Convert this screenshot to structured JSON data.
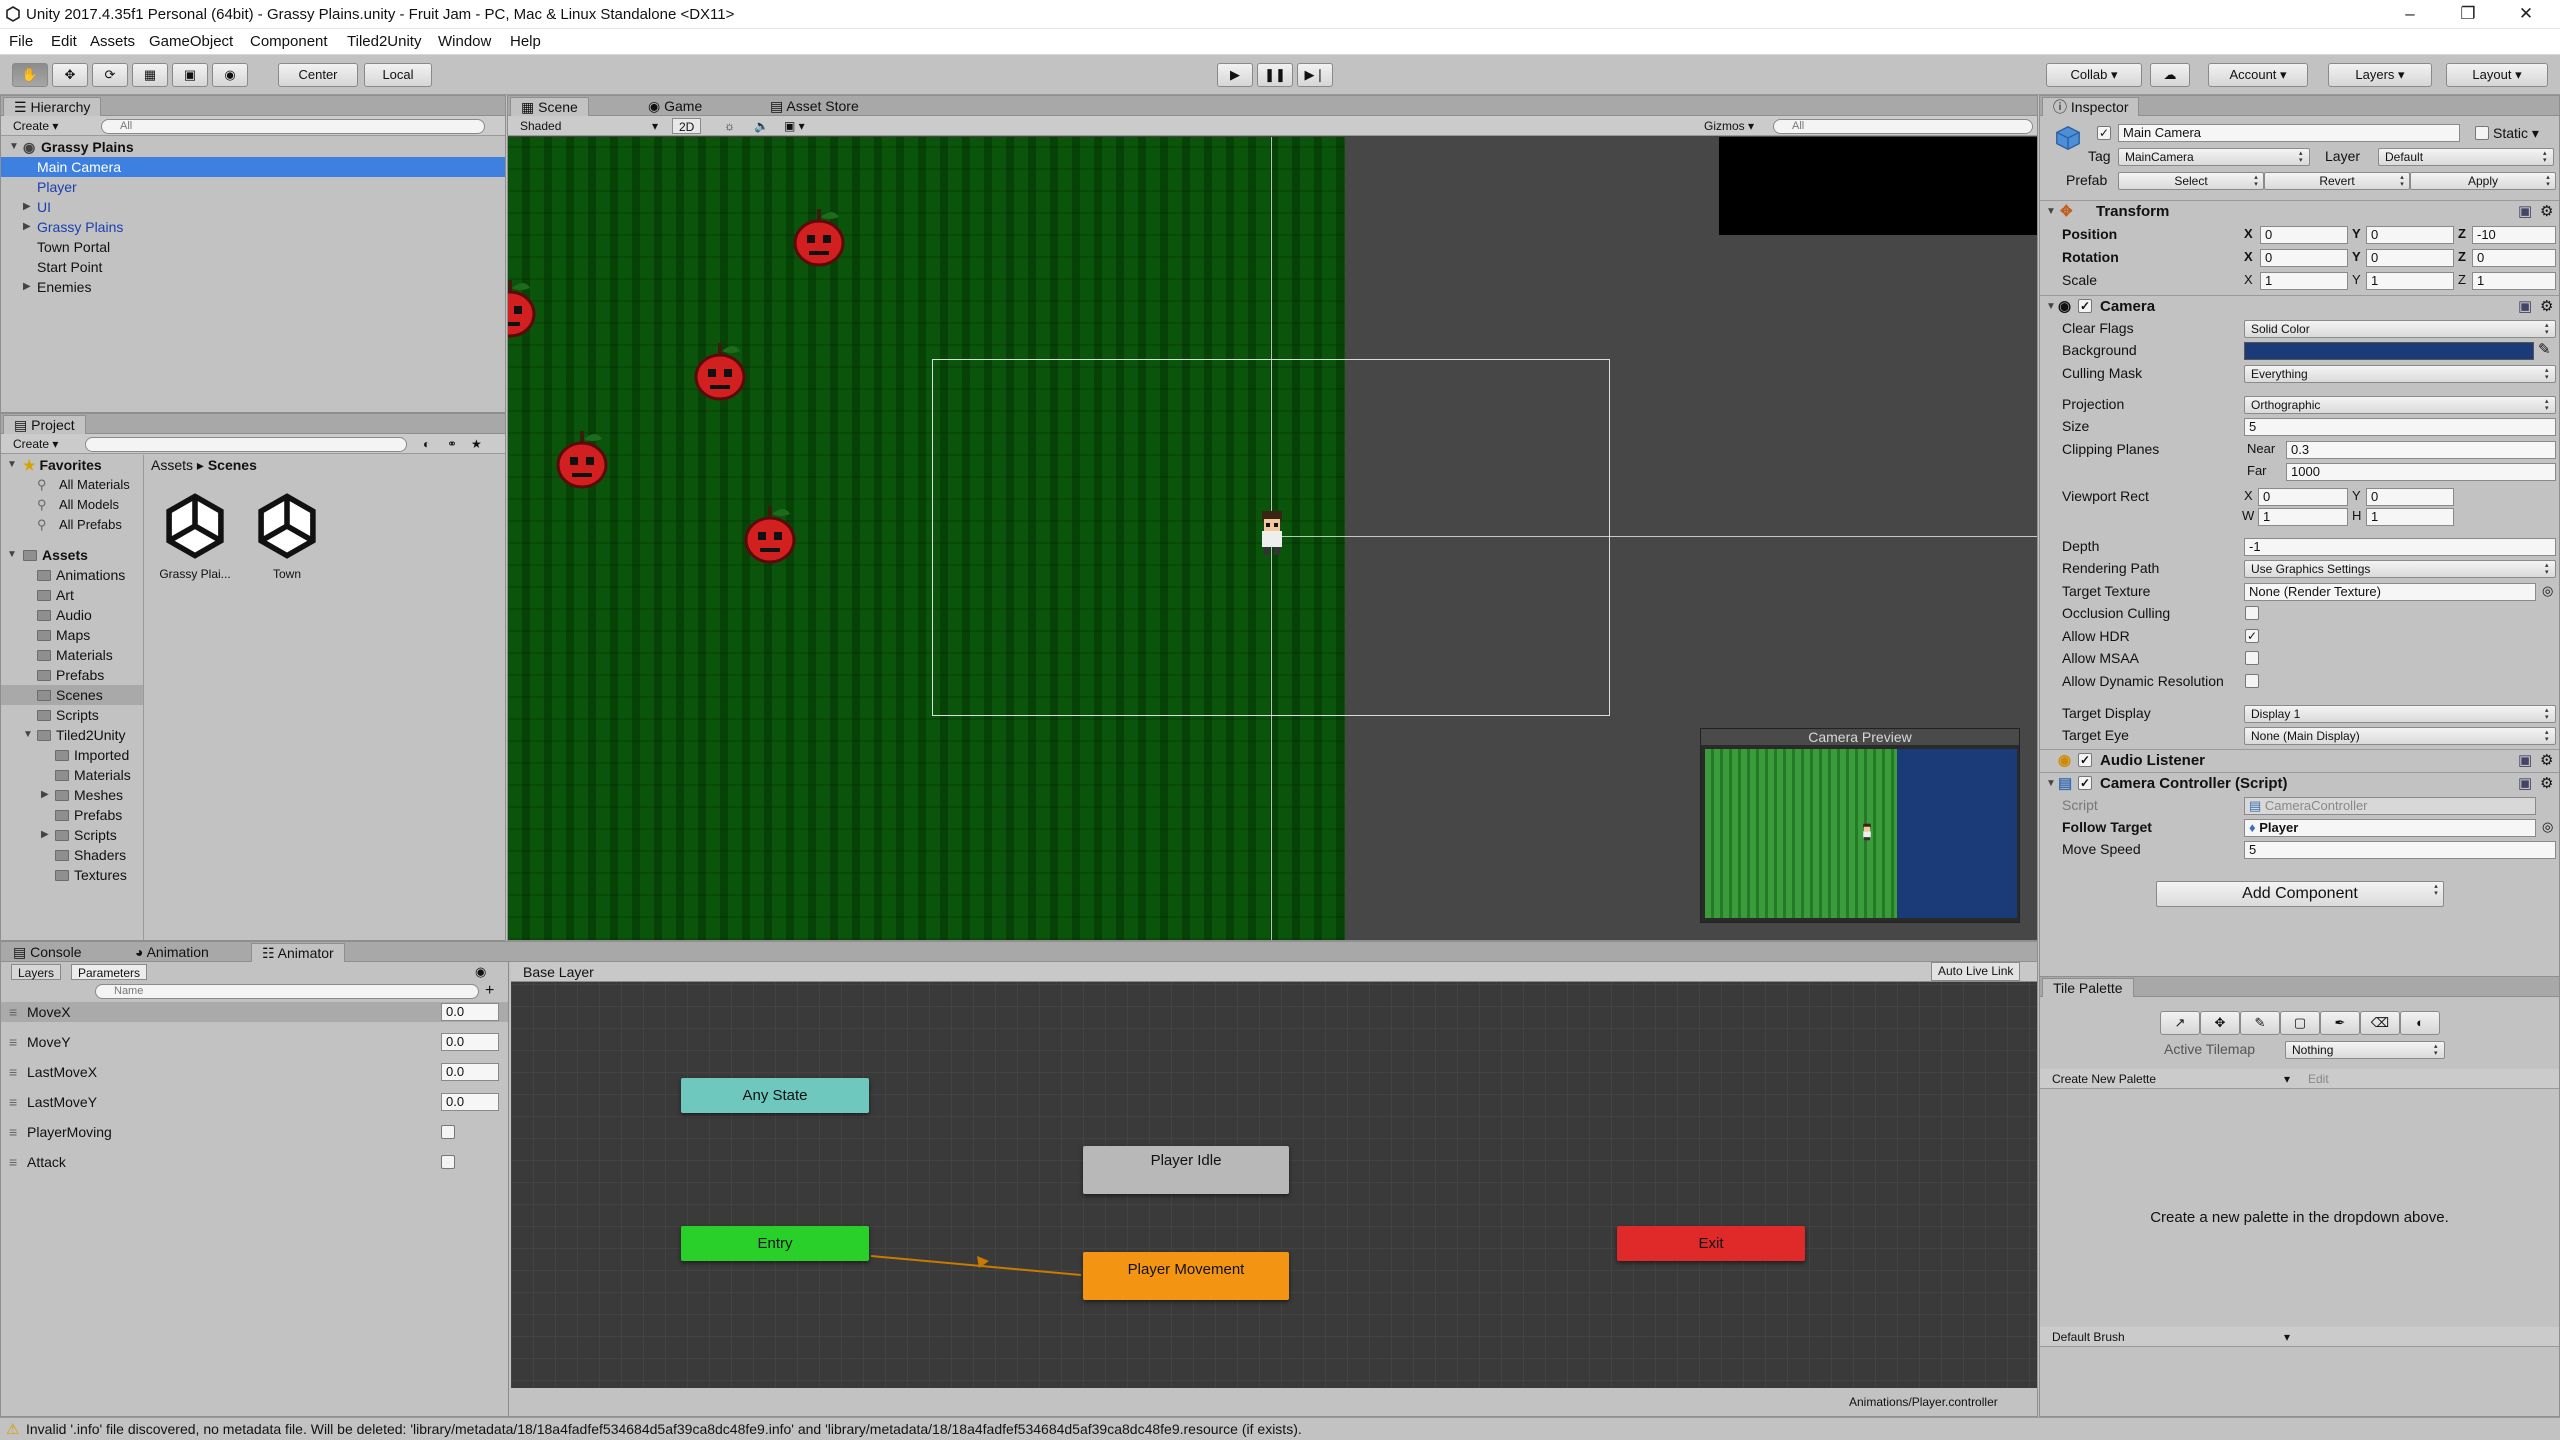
{
  "window": {
    "title": "Unity 2017.4.35f1 Personal (64bit) - Grassy Plains.unity - Fruit Jam - PC, Mac & Linux Standalone <DX11>"
  },
  "menu": [
    "File",
    "Edit",
    "Assets",
    "GameObject",
    "Component",
    "Tiled2Unity",
    "Window",
    "Help"
  ],
  "toolbar": {
    "pivot": "Center",
    "space": "Local",
    "collab": "Collab ▾",
    "account": "Account",
    "layers": "Layers",
    "layout": "Layout"
  },
  "hierarchy": {
    "title": "Hierarchy",
    "create": "Create ▾",
    "search": "All",
    "scene": "Grassy Plains",
    "items": [
      {
        "label": "Main Camera"
      },
      {
        "label": "Player"
      },
      {
        "label": "UI"
      },
      {
        "label": "Grassy Plains"
      },
      {
        "label": "Town Portal"
      },
      {
        "label": "Start Point"
      },
      {
        "label": "Enemies"
      }
    ]
  },
  "project": {
    "title": "Project",
    "create": "Create ▾",
    "favorites": "Favorites",
    "fav_items": [
      "All Materials",
      "All Models",
      "All Prefabs"
    ],
    "assets": "Assets",
    "asset_items": [
      "Animations",
      "Art",
      "Audio",
      "Maps",
      "Materials",
      "Prefabs",
      "Scenes",
      "Scripts",
      "Tiled2Unity"
    ],
    "tiled_items": [
      "Imported",
      "Materials",
      "Meshes",
      "Prefabs",
      "Scripts",
      "Shaders",
      "Textures"
    ],
    "crumb1": "Assets",
    "crumb2": "Scenes",
    "files": [
      "Grassy Plai...",
      "Town"
    ]
  },
  "scene": {
    "tabs": [
      "Scene",
      "Game",
      "Asset Store"
    ],
    "shading": "Shaded",
    "mode2d": "2D",
    "gizmos": "Gizmos ▾",
    "search": "All",
    "preview_title": "Camera Preview"
  },
  "inspector": {
    "title": "Inspector",
    "object": "Main Camera",
    "static": "Static",
    "tag_label": "Tag",
    "tag": "MainCamera",
    "layer_label": "Layer",
    "layer": "Default",
    "prefab_label": "Prefab",
    "prefab_select": "Select",
    "prefab_revert": "Revert",
    "prefab_apply": "Apply",
    "transform": {
      "title": "Transform",
      "position": "Position",
      "rotation": "Rotation",
      "scale": "Scale",
      "pos": [
        "0",
        "0",
        "-10"
      ],
      "rot": [
        "0",
        "0",
        "0"
      ],
      "scl": [
        "1",
        "1",
        "1"
      ]
    },
    "camera": {
      "title": "Camera",
      "clear_flags_l": "Clear Flags",
      "clear_flags": "Solid Color",
      "background_l": "Background",
      "background_color": "#1b3a78",
      "culling_l": "Culling Mask",
      "culling": "Everything",
      "projection_l": "Projection",
      "projection": "Orthographic",
      "size_l": "Size",
      "size": "5",
      "clipping_l": "Clipping Planes",
      "near_l": "Near",
      "near": "0.3",
      "far_l": "Far",
      "far": "1000",
      "viewport_l": "Viewport Rect",
      "vx": "0",
      "vy": "0",
      "vw": "1",
      "vh": "1",
      "depth_l": "Depth",
      "depth": "-1",
      "rpath_l": "Rendering Path",
      "rpath": "Use Graphics Settings",
      "ttex_l": "Target Texture",
      "ttex": "None (Render Texture)",
      "occ_l": "Occlusion Culling",
      "hdr_l": "Allow HDR",
      "msaa_l": "Allow MSAA",
      "dyn_l": "Allow Dynamic Resolution",
      "tdisp_l": "Target Display",
      "tdisp": "Display 1",
      "teye_l": "Target Eye",
      "teye": "None (Main Display)"
    },
    "audio": "Audio Listener",
    "controller": {
      "title": "Camera Controller (Script)",
      "script_l": "Script",
      "script": "CameraController",
      "follow_l": "Follow Target",
      "follow": "Player",
      "speed_l": "Move Speed",
      "speed": "5"
    },
    "add_component": "Add Component"
  },
  "bottom": {
    "tabs": [
      "Console",
      "Animation",
      "Animator"
    ],
    "layers_tab": "Layers",
    "params_tab": "Parameters",
    "search": "Name",
    "params": [
      {
        "name": "MoveX",
        "value": "0.0"
      },
      {
        "name": "MoveY",
        "value": "0.0"
      },
      {
        "name": "LastMoveX",
        "value": "0.0"
      },
      {
        "name": "LastMoveY",
        "value": "0.0"
      },
      {
        "name": "PlayerMoving",
        "value": ""
      },
      {
        "name": "Attack",
        "value": ""
      }
    ],
    "base_layer": "Base Layer",
    "auto_live": "Auto Live Link",
    "states": {
      "any": "Any State",
      "entry": "Entry",
      "idle": "Player Idle",
      "movement": "Player Movement",
      "exit": "Exit"
    },
    "controller_path": "Animations/Player.controller"
  },
  "tile_palette": {
    "title": "Tile Palette",
    "active_l": "Active Tilemap",
    "active": "Nothing",
    "create": "Create New Palette",
    "edit": "Edit",
    "hint": "Create a new palette in the dropdown above.",
    "brush": "Default Brush"
  },
  "status": "Invalid '.info' file discovered, no metadata file. Will be deleted: 'library/metadata/18/18a4fadfef534684d5af39ca8dc48fe9.info' and 'library/metadata/18/18a4fadfef534684d5af39ca8dc48fe9.resource (if exists)."
}
